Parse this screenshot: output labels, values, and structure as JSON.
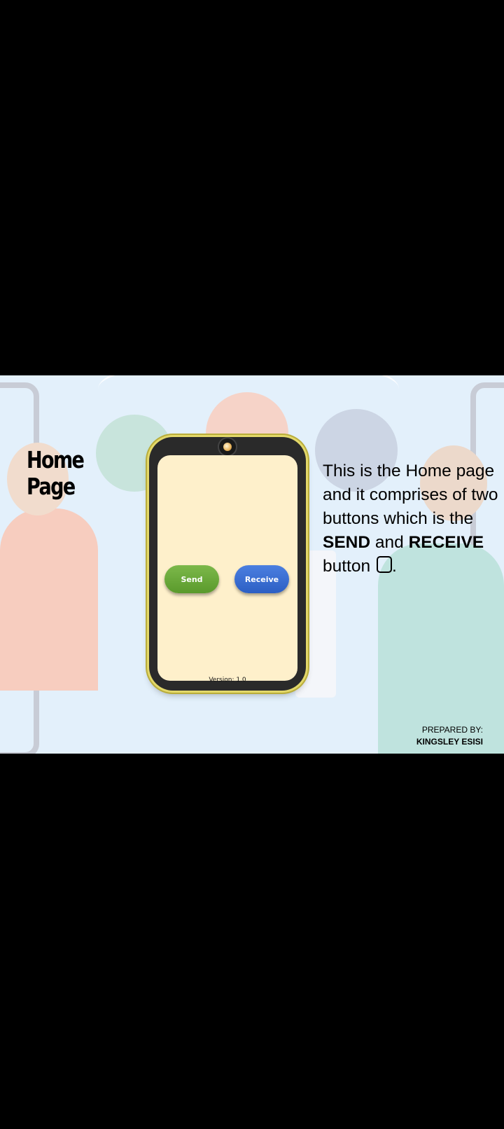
{
  "slide": {
    "title_line1": "Home",
    "title_line2": "Page",
    "description": {
      "part1": "This is the Home page and it comprises of two buttons which is the ",
      "send_bold": "SEND",
      "part2": " and ",
      "receive_bold": "RECEIVE",
      "part3": " button ",
      "part4": "."
    },
    "credit_label": "PREPARED BY:",
    "credit_name": "KINGSLEY ESISI"
  },
  "phone": {
    "send_label": "Send",
    "receive_label": "Receive",
    "version_text": "Version: 1.0",
    "send_color": "#6aa83a",
    "receive_color": "#3a6fd4",
    "screen_color": "#fef0cb"
  }
}
